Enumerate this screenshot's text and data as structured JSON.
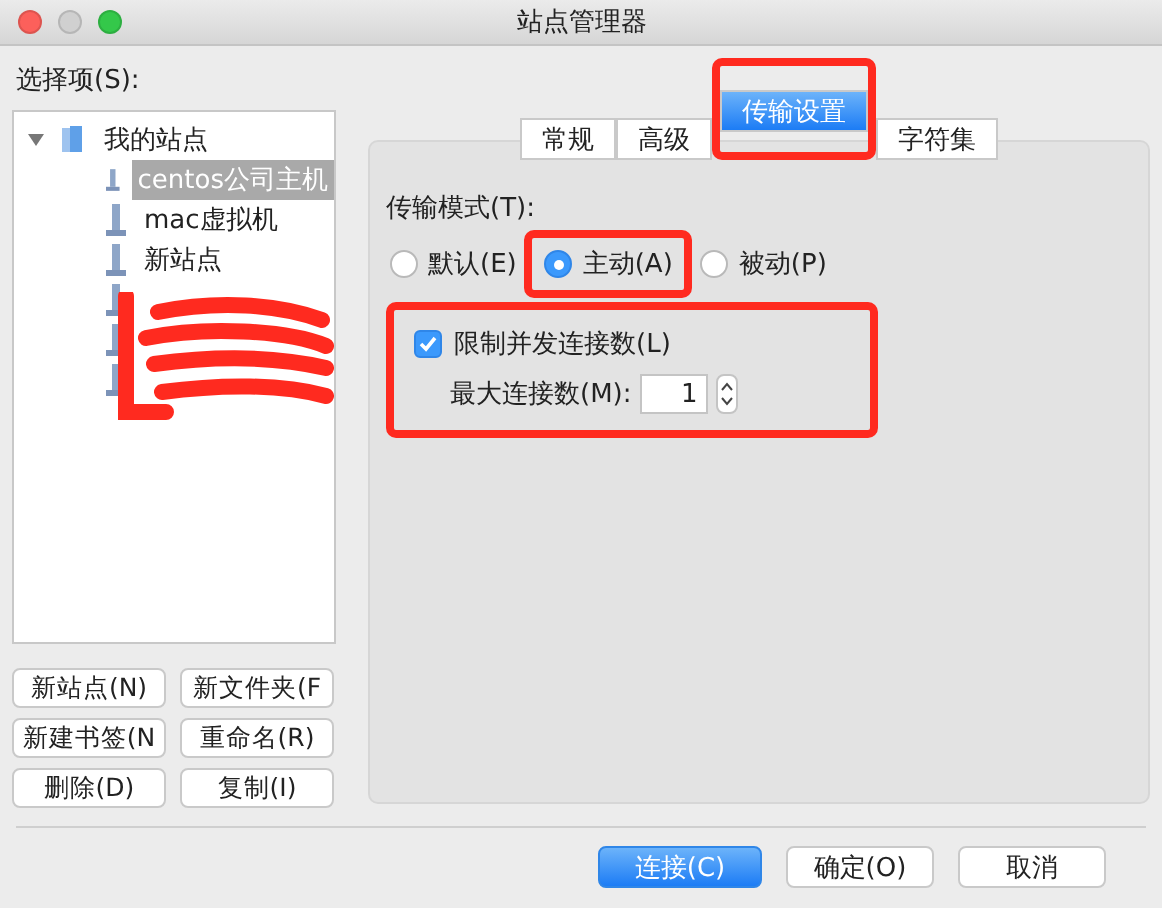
{
  "window": {
    "title": "站点管理器"
  },
  "sidebar": {
    "label": "选择项(S):",
    "tree": [
      {
        "label": "我的站点",
        "expanded": true,
        "children": [
          {
            "kind": "site",
            "label": "centos公司主机",
            "selected": true
          },
          {
            "kind": "site",
            "label": "mac虚拟机",
            "selected": false
          },
          {
            "kind": "site",
            "label": "新站点",
            "selected": false
          },
          {
            "kind": "redacted"
          },
          {
            "kind": "redacted"
          },
          {
            "kind": "redacted"
          }
        ]
      }
    ],
    "buttons": [
      "新站点(N)",
      "新文件夹(F",
      "新建书签(N",
      "重命名(R)",
      "删除(D)",
      "复制(I)"
    ]
  },
  "tabs": [
    {
      "label": "常规",
      "selected": false,
      "annotated": false
    },
    {
      "label": "高级",
      "selected": false,
      "annotated": false
    },
    {
      "label": "传输设置",
      "selected": true,
      "annotated": true
    },
    {
      "label": "字符集",
      "selected": false,
      "annotated": false
    }
  ],
  "transfer": {
    "mode_label": "传输模式(T):",
    "modes": [
      {
        "label": "默认(E)",
        "selected": false,
        "annotated": false
      },
      {
        "label": "主动(A)",
        "selected": true,
        "annotated": true
      },
      {
        "label": "被动(P)",
        "selected": false,
        "annotated": false
      }
    ],
    "limit": {
      "label": "限制并发连接数(L)",
      "checked": true,
      "annotated": true
    },
    "max": {
      "label": "最大连接数(M):",
      "value": "1"
    }
  },
  "footer": [
    {
      "label": "连接(C)",
      "kind": "primary"
    },
    {
      "label": "确定(O)",
      "kind": "normal"
    },
    {
      "label": "取消",
      "kind": "normal"
    }
  ]
}
